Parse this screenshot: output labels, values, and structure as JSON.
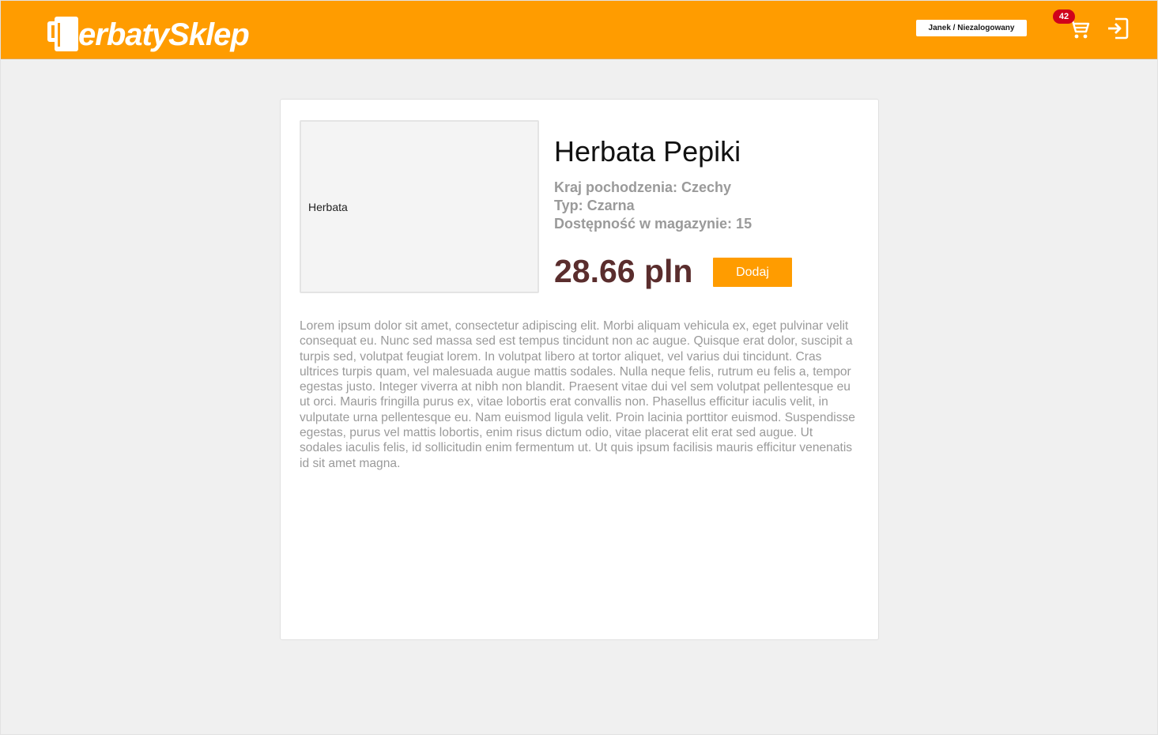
{
  "header": {
    "logo_text": "erbatySklep",
    "logo_icon": "teacup-icon",
    "user_label": "Janek / Niezalogowany",
    "cart_count": "42",
    "cart_icon": "shopping-cart-icon",
    "login_icon": "login-icon",
    "brand_color": "#ff9c00",
    "badge_color": "#d0021b"
  },
  "product": {
    "image_alt": "Herbata",
    "name": "Herbata Pepiki",
    "origin": "Kraj pochodzenia: Czechy",
    "type": "Typ: Czarna",
    "availability": "Dostępność w magazynie: 15",
    "price": "28.66 pln",
    "add_button": "Dodaj",
    "price_color": "#5a2d2d",
    "description": " Lorem ipsum dolor sit amet, consectetur adipiscing elit. Morbi aliquam vehicula ex, eget pulvinar velit consequat eu. Nunc sed massa sed est tempus tincidunt non ac augue. Quisque erat dolor, suscipit a turpis sed, volutpat feugiat lorem. In volutpat libero at tortor aliquet, vel varius dui tincidunt. Cras ultrices turpis quam, vel malesuada augue mattis sodales. Nulla neque felis, rutrum eu felis a, tempor egestas justo. Integer viverra at nibh non blandit. Praesent vitae dui vel sem volutpat pellentesque eu ut orci. Mauris fringilla purus ex, vitae lobortis erat convallis non. Phasellus efficitur iaculis velit, in vulputate urna pellentesque eu. Nam euismod ligula velit. Proin lacinia porttitor euismod. Suspendisse egestas, purus vel mattis lobortis, enim risus dictum odio, vitae placerat elit erat sed augue. Ut sodales iaculis felis, id sollicitudin enim fermentum ut. Ut quis ipsum facilisis mauris efficitur venenatis id sit amet magna."
  }
}
